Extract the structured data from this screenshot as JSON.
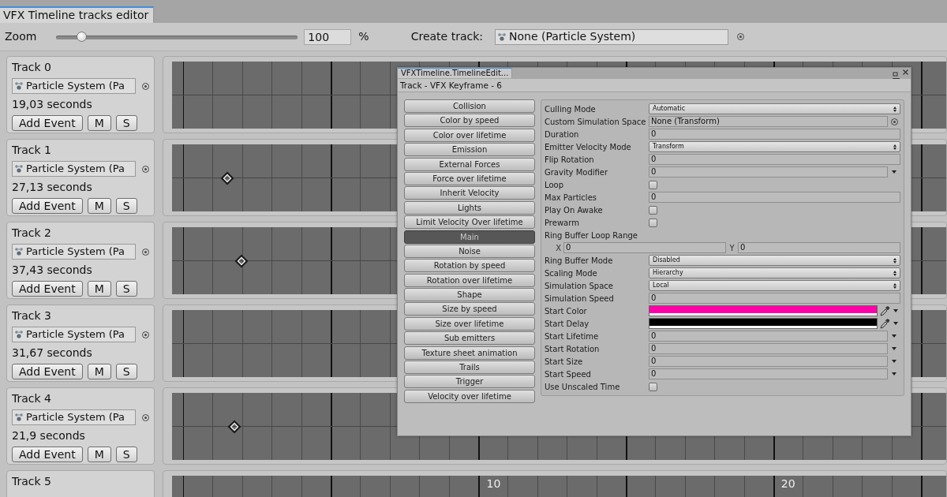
{
  "window": {
    "tab": {
      "label": "VFX Timeline tracks editor",
      "selected": true
    }
  },
  "toolbar": {
    "zoom_label": "Zoom",
    "zoom_slider": {
      "level": 0.105
    },
    "zoom_value": "100",
    "zoom_unit": "%",
    "create_track_label": "Create track:",
    "create_track_field": "None (Particle System)"
  },
  "tracks": [
    {
      "name": "Track 0",
      "object": "Particle System (Pa",
      "duration": "19,03 seconds",
      "buttons": [
        "Add Event",
        "M",
        "S"
      ]
    },
    {
      "name": "Track 1",
      "object": "Particle System (Pa",
      "duration": "27,13 seconds",
      "buttons": [
        "Add Event",
        "M",
        "S"
      ],
      "keyframes": [
        {
          "level": 0.071
        }
      ]
    },
    {
      "name": "Track 2",
      "object": "Particle System (Pa",
      "duration": "37,43 seconds",
      "buttons": [
        "Add Event",
        "M",
        "S"
      ],
      "keyframes": [
        {
          "level": 0.09
        }
      ]
    },
    {
      "name": "Track 3",
      "object": "Particle System (Pa",
      "duration": "31,67 seconds",
      "buttons": [
        "Add Event",
        "M",
        "S"
      ]
    },
    {
      "name": "Track 4",
      "object": "Particle System (Pa",
      "duration": "21,9 seconds",
      "buttons": [
        "Add Event",
        "M",
        "S"
      ],
      "keyframes": [
        {
          "level": 0.08
        }
      ]
    },
    {
      "name": "Track 5",
      "ruler": [
        {
          "text": "10",
          "level": 0.41
        },
        {
          "text": "20",
          "level": 0.79
        }
      ]
    }
  ],
  "inspector": {
    "tab": "VFXTimeline.TimelineEdit...",
    "title": "Track - VFX Keyframe - 6",
    "modules": [
      {
        "label": "Collision",
        "selected": false
      },
      {
        "label": "Color by speed",
        "selected": false
      },
      {
        "label": "Color over lifetime",
        "selected": false
      },
      {
        "label": "Emission",
        "selected": false
      },
      {
        "label": "External Forces",
        "selected": false
      },
      {
        "label": "Force over lifetime",
        "selected": false
      },
      {
        "label": "Inherit Velocity",
        "selected": false
      },
      {
        "label": "Lights",
        "selected": false
      },
      {
        "label": "Limit Velocity Over lifetime",
        "selected": false
      },
      {
        "label": "Main",
        "selected": true
      },
      {
        "label": "Noise",
        "selected": false
      },
      {
        "label": "Rotation by speed",
        "selected": false
      },
      {
        "label": "Rotation over lifetime",
        "selected": false
      },
      {
        "label": "Shape",
        "selected": false
      },
      {
        "label": "Size by speed",
        "selected": false
      },
      {
        "label": "Size over lifetime",
        "selected": false
      },
      {
        "label": "Sub emitters",
        "selected": false
      },
      {
        "label": "Texture sheet animation",
        "selected": false
      },
      {
        "label": "Trails",
        "selected": false
      },
      {
        "label": "Trigger",
        "selected": false
      },
      {
        "label": "Velocity over lifetime",
        "selected": false
      }
    ],
    "properties": [
      {
        "kind": "dropdown",
        "label": "Culling Mode",
        "value": "Automatic"
      },
      {
        "kind": "object",
        "label": "Custom Simulation Space",
        "value": "None (Transform)"
      },
      {
        "kind": "number",
        "label": "Duration",
        "value": "0"
      },
      {
        "kind": "dropdown",
        "label": "Emitter Velocity Mode",
        "value": "Transform"
      },
      {
        "kind": "number",
        "label": "Flip Rotation",
        "value": "0"
      },
      {
        "kind": "curve",
        "label": "Gravity Modifier",
        "value": "0"
      },
      {
        "kind": "checkbox",
        "label": "Loop",
        "checked": false
      },
      {
        "kind": "number",
        "label": "Max Particles",
        "value": "0"
      },
      {
        "kind": "checkbox",
        "label": "Play On Awake",
        "checked": false
      },
      {
        "kind": "checkbox",
        "label": "Prewarm",
        "checked": false
      },
      {
        "kind": "header",
        "label": "Ring Buffer Loop Range"
      },
      {
        "kind": "vector2",
        "x_label": "X",
        "x_value": "0",
        "y_label": "Y",
        "y_value": "0"
      },
      {
        "kind": "dropdown",
        "label": "Ring Buffer Mode",
        "value": "Disabled"
      },
      {
        "kind": "dropdown",
        "label": "Scaling Mode",
        "value": "Hierarchy"
      },
      {
        "kind": "dropdown",
        "label": "Simulation Space",
        "value": "Local"
      },
      {
        "kind": "number",
        "label": "Simulation Speed",
        "value": "0"
      },
      {
        "kind": "color",
        "label": "Start Color",
        "color": "#ff00a8"
      },
      {
        "kind": "color",
        "label": "Start Delay",
        "color": "#000000"
      },
      {
        "kind": "curve",
        "label": "Start Lifetime",
        "value": "0"
      },
      {
        "kind": "curve",
        "label": "Start Rotation",
        "value": "0"
      },
      {
        "kind": "curve",
        "label": "Start Size",
        "value": "0"
      },
      {
        "kind": "curve",
        "label": "Start Speed",
        "value": "0"
      },
      {
        "kind": "checkbox",
        "label": "Use Unscaled Time",
        "checked": false
      }
    ]
  }
}
